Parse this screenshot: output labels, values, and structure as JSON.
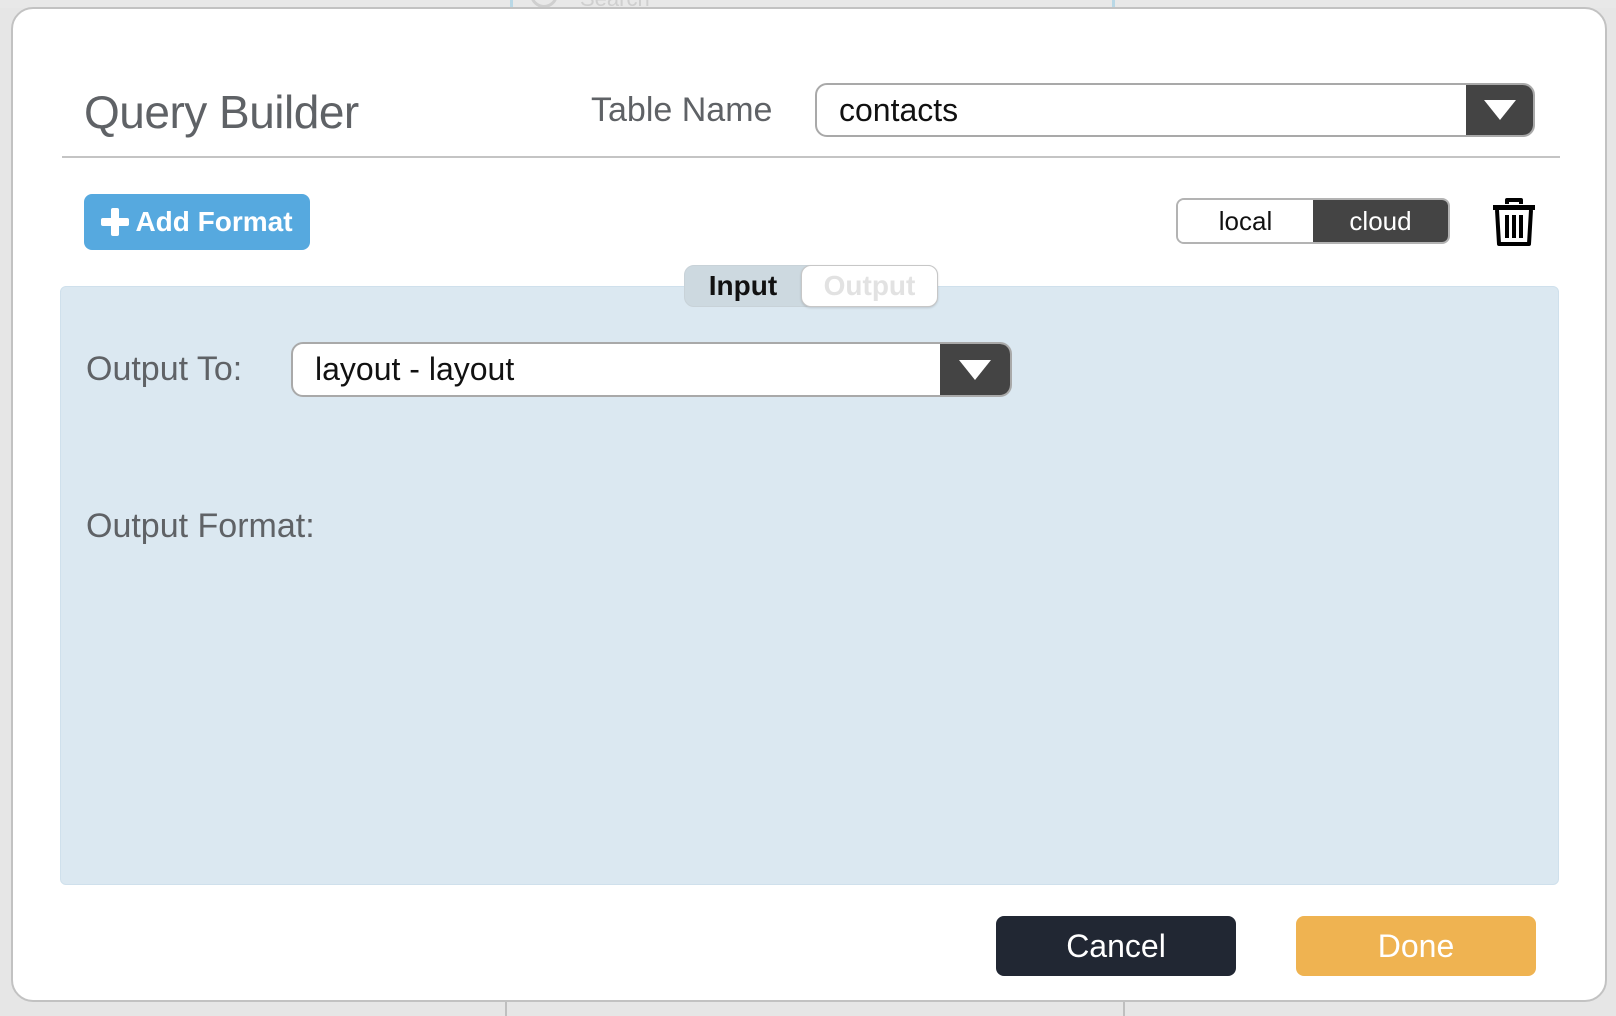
{
  "background": {
    "search_placeholder": "Search"
  },
  "dialog": {
    "title": "Query Builder",
    "table_name_label": "Table Name",
    "table_name_value": "contacts",
    "add_format_label": "Add Format",
    "storage_toggle": {
      "options": [
        "local",
        "cloud"
      ],
      "selected": "cloud"
    },
    "io_tabs": {
      "items": [
        "Input",
        "Output"
      ],
      "active": "Input"
    },
    "output_to_label": "Output To:",
    "output_to_value": "layout - layout",
    "output_format_label": "Output Format:",
    "cancel_label": "Cancel",
    "done_label": "Done"
  },
  "colors": {
    "add_button": "#56a9df",
    "panel_background": "#dbe8f1",
    "cancel_button": "#212733",
    "done_button": "#efb351",
    "dropdown_button": "#444444"
  },
  "icons": {
    "dropdown": "chevron-down-icon",
    "add": "plus-icon",
    "delete": "trash-icon"
  }
}
